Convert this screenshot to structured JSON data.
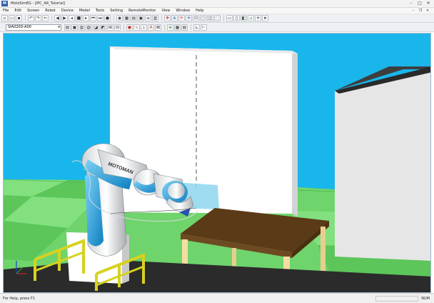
{
  "window": {
    "title": "MotoSimEG - [IPC_AR_Tutorial]"
  },
  "menu": [
    "File",
    "Edit",
    "Screen",
    "Robot",
    "Device",
    "Model",
    "Tools",
    "Setting",
    "RemoteMonitor",
    "View",
    "Window",
    "Help"
  ],
  "toolbar": {
    "robot_select": "SIA020D-A00"
  },
  "status": {
    "text": "For Help, press F1",
    "num": "NUM"
  },
  "colors": {
    "sky": "#19b6ec",
    "ground": "#6ed46b",
    "table_top": "#5a3a18",
    "table_legs": "#f5dca3",
    "fence": "#d6d21f",
    "robot_accent": "#1a9ad8"
  }
}
